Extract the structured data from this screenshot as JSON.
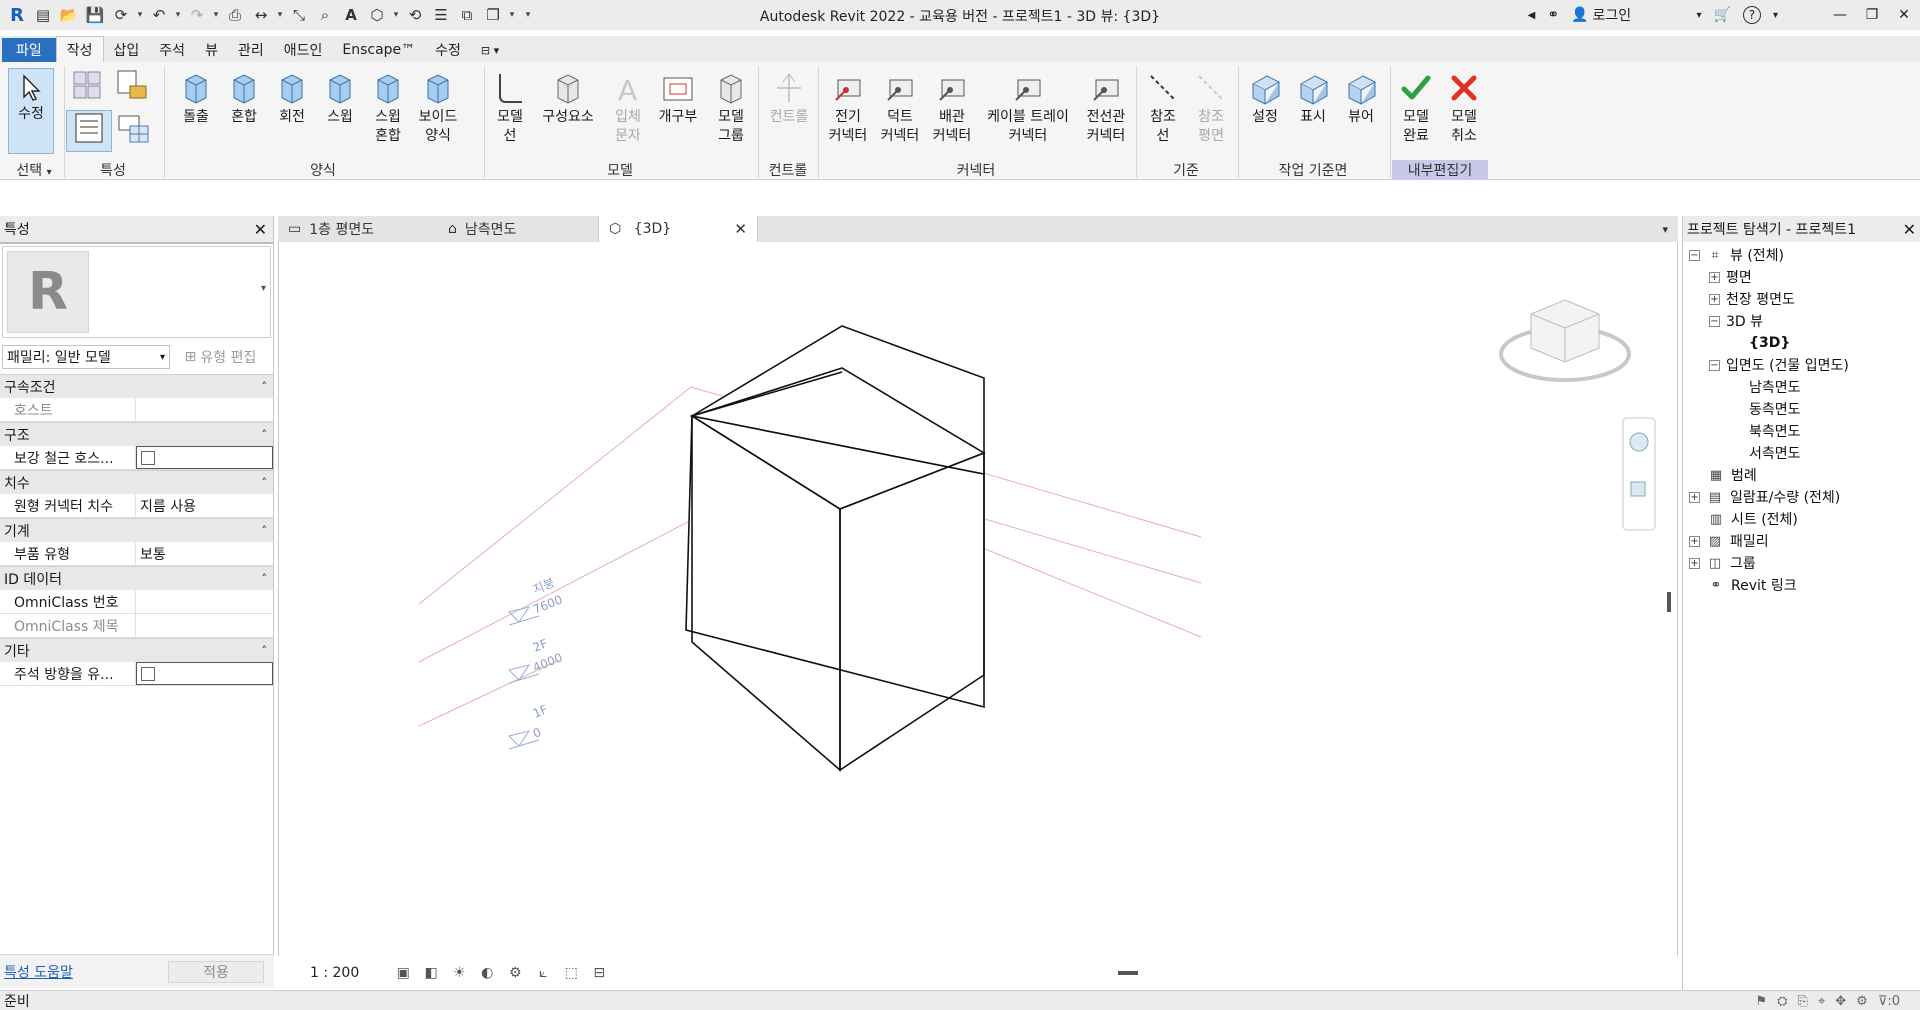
{
  "app": {
    "title": "Autodesk Revit 2022 - 교육용 버전 - 프로젝트1 - 3D 뷰: {3D}",
    "login_label": "로그인",
    "help_icon": "?"
  },
  "ribbon_tabs": [
    "파일",
    "작성",
    "삽입",
    "주석",
    "뷰",
    "관리",
    "애드인",
    "Enscape™",
    "수정"
  ],
  "ribbon": {
    "select_panel": {
      "modify_label": "수정",
      "panel_label": "선택"
    },
    "properties_panel": {
      "panel_label": "특성"
    },
    "forms_panel": {
      "panel_label": "양식",
      "buttons": [
        {
          "label": "돌출",
          "sub": ""
        },
        {
          "label": "혼합",
          "sub": ""
        },
        {
          "label": "회전",
          "sub": ""
        },
        {
          "label": "스윕",
          "sub": ""
        },
        {
          "label": "스윕",
          "sub": "혼합"
        },
        {
          "label": "보이드",
          "sub": "양식"
        }
      ]
    },
    "model_panel": {
      "panel_label": "모델",
      "buttons": [
        {
          "label": "모델",
          "sub": "선",
          "disabled": false
        },
        {
          "label": "구성요소",
          "sub": "",
          "disabled": false
        },
        {
          "label": "입체",
          "sub": "문자",
          "disabled": true
        },
        {
          "label": "개구부",
          "sub": "",
          "disabled": false
        },
        {
          "label": "모델",
          "sub": "그룹",
          "disabled": false
        }
      ]
    },
    "control_panel": {
      "panel_label": "컨트롤",
      "button": "컨트롤"
    },
    "connectors_panel": {
      "panel_label": "커넥터",
      "buttons": [
        {
          "label": "전기",
          "sub": "커넥터"
        },
        {
          "label": "덕트",
          "sub": "커넥터"
        },
        {
          "label": "배관",
          "sub": "커넥터"
        },
        {
          "label": "케이블 트레이",
          "sub": "커넥터"
        },
        {
          "label": "전선관",
          "sub": "커넥터"
        }
      ]
    },
    "datum_panel": {
      "panel_label": "기준",
      "buttons": [
        {
          "label": "참조",
          "sub": "선",
          "disabled": false
        },
        {
          "label": "참조",
          "sub": "평면",
          "disabled": true
        }
      ]
    },
    "workplane_panel": {
      "panel_label": "작업 기준면",
      "buttons": [
        {
          "label": "설정"
        },
        {
          "label": "표시"
        },
        {
          "label": "뷰어"
        }
      ]
    },
    "inplace_panel": {
      "panel_label": "내부편집기",
      "finish": {
        "label": "모델",
        "sub": "완료"
      },
      "cancel": {
        "label": "모델",
        "sub": "취소"
      }
    }
  },
  "properties": {
    "title": "특성",
    "family_selector": "패밀리: 일반 모델",
    "edit_type": "유형 편집",
    "groups": [
      {
        "name": "구속조건",
        "rows": [
          {
            "name": "호스트",
            "value": "",
            "greyed": true
          }
        ]
      },
      {
        "name": "구조",
        "rows": [
          {
            "name": "보강 철근 호스...",
            "value": "",
            "checkbox": true
          }
        ]
      },
      {
        "name": "치수",
        "rows": [
          {
            "name": "원형 커넥터 치수",
            "value": "지름 사용"
          }
        ]
      },
      {
        "name": "기계",
        "rows": [
          {
            "name": "부품 유형",
            "value": "보통"
          }
        ]
      },
      {
        "name": "ID 데이터",
        "rows": [
          {
            "name": "OmniClass 번호",
            "value": ""
          },
          {
            "name": "OmniClass 제목",
            "value": "",
            "greyed": true
          }
        ]
      },
      {
        "name": "기타",
        "rows": [
          {
            "name": "주석 방향을 유...",
            "value": "",
            "checkbox": true
          }
        ]
      }
    ],
    "help_link": "특성 도움말",
    "apply_button": "적용"
  },
  "view_tabs": [
    {
      "label": "1층 평면도"
    },
    {
      "label": "남측면도"
    },
    {
      "label": "{3D}"
    }
  ],
  "view_controls": {
    "scale": "1 : 200"
  },
  "levels": [
    {
      "name": "지붕",
      "elevation": "7600"
    },
    {
      "name": "2F",
      "elevation": "4000"
    },
    {
      "name": "1F",
      "elevation": "0"
    }
  ],
  "browser": {
    "title": "프로젝트 탐색기 - 프로젝트1",
    "items": [
      {
        "label": "뷰 (전체)"
      },
      {
        "label": "평면"
      },
      {
        "label": "천장 평면도"
      },
      {
        "label": "3D 뷰"
      },
      {
        "label": "{3D}"
      },
      {
        "label": "입면도 (건물 입면도)"
      },
      {
        "label": "남측면도"
      },
      {
        "label": "동측면도"
      },
      {
        "label": "북측면도"
      },
      {
        "label": "서측면도"
      },
      {
        "label": "범례"
      },
      {
        "label": "일람표/수량 (전체)"
      },
      {
        "label": "시트 (전체)"
      },
      {
        "label": "패밀리"
      },
      {
        "label": "그룹"
      },
      {
        "label": "Revit 링크"
      }
    ]
  },
  "status": {
    "text": "준비",
    "filter_count": ":0"
  },
  "colors": {
    "file_tab": "#2b6fc0",
    "finish_green": "#2ea043",
    "cancel_red": "#e0322b",
    "inplace_label_bg": "#c8c8e8"
  }
}
